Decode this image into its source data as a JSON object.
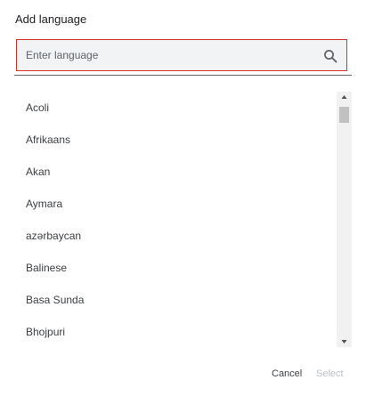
{
  "dialog": {
    "title": "Add language",
    "search": {
      "placeholder": "Enter language",
      "value": "",
      "icon": "search-icon"
    },
    "languages": [
      "Acoli",
      "Afrikaans",
      "Akan",
      "Aymara",
      "azərbaycan",
      "Balinese",
      "Basa Sunda",
      "Bhojpuri"
    ],
    "buttons": {
      "cancel": "Cancel",
      "select": "Select"
    },
    "colors": {
      "focus_border": "#d93025",
      "disabled_text": "#bdc1c6"
    }
  }
}
